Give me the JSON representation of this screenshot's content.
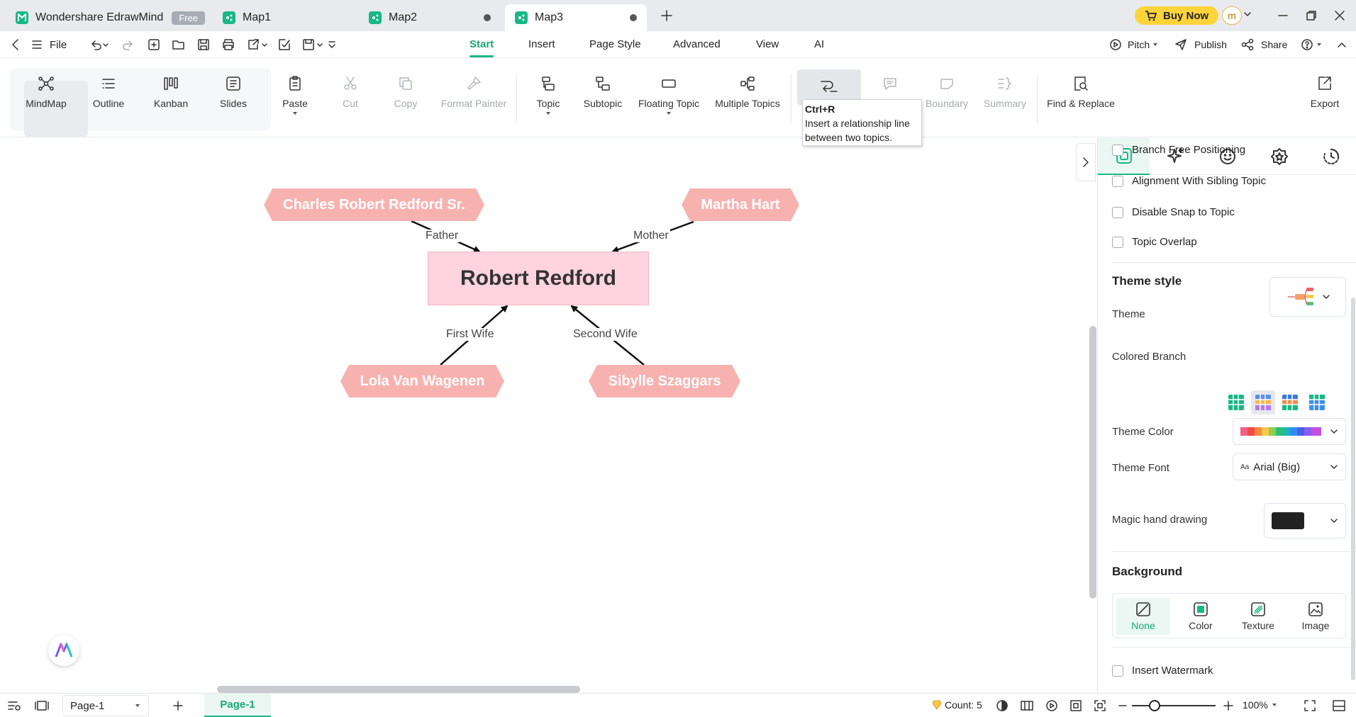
{
  "app": {
    "name": "Wondershare EdrawMind",
    "plan_badge": "Free"
  },
  "tabs": [
    {
      "label": "Map1"
    },
    {
      "label": "Map2"
    },
    {
      "label": "Map3"
    }
  ],
  "titlebar": {
    "buy_now": "Buy Now",
    "avatar_initial": "m"
  },
  "menubar": {
    "file": "File",
    "tabs": [
      "Start",
      "Insert",
      "Page Style",
      "Advanced",
      "View",
      "AI"
    ],
    "pitch": "Pitch",
    "publish": "Publish",
    "share": "Share"
  },
  "ribbon": {
    "views": [
      "MindMap",
      "Outline",
      "Kanban",
      "Slides"
    ],
    "paste": "Paste",
    "cut": "Cut",
    "copy": "Copy",
    "format_painter": "Format Painter",
    "topic": "Topic",
    "subtopic": "Subtopic",
    "floating_topic": "Floating Topic",
    "multiple_topics": "Multiple Topics",
    "boundary": "Boundary",
    "summary": "Summary",
    "find_replace": "Find & Replace",
    "export": "Export"
  },
  "tooltip": {
    "shortcut": "Ctrl+R",
    "line1": "Insert a relationship line",
    "line2": "between two topics."
  },
  "mindmap": {
    "central": "Robert Redford",
    "topics": [
      "Charles Robert Redford Sr.",
      "Martha Hart",
      "Lola Van Wagenen",
      "Sibylle Szaggars"
    ],
    "relations": [
      "Father",
      "Mother",
      "First Wife",
      "Second Wife"
    ],
    "colors": {
      "central_fill": "#ffd3df",
      "topic_fill": "#f7b2b0"
    }
  },
  "panel": {
    "checkboxes": [
      "Branch Free Positioning",
      "Alignment With Sibling Topic",
      "Disable Snap to Topic",
      "Topic Overlap"
    ],
    "theme_style_title": "Theme style",
    "theme": "Theme",
    "colored_branch": "Colored Branch",
    "theme_color": "Theme Color",
    "theme_font": "Theme Font",
    "theme_font_value": "Arial (Big)",
    "font_prefix": "Aa",
    "magic_hand": "Magic hand drawing",
    "background_title": "Background",
    "bg_options": [
      "None",
      "Color",
      "Texture",
      "Image"
    ],
    "watermark": "Insert Watermark",
    "accent": "#18b884"
  },
  "statusbar": {
    "page_select": "Page-1",
    "page_tab": "Page-1",
    "count": "Count: 5",
    "zoom": "100%"
  }
}
